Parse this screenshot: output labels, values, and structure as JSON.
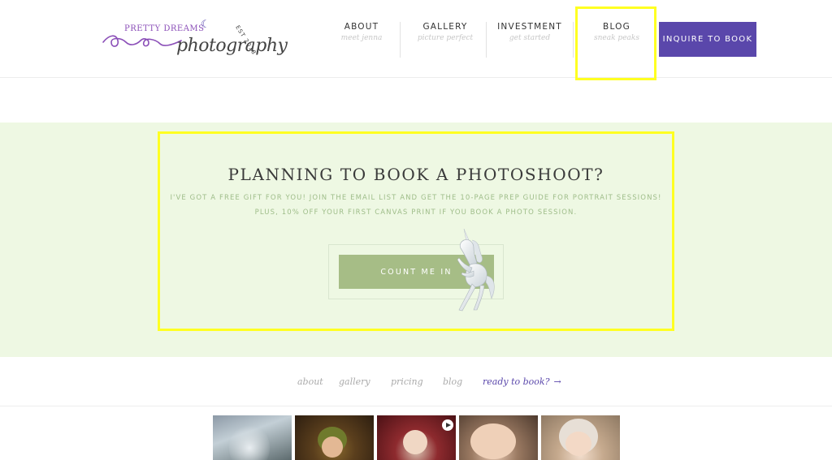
{
  "brand": {
    "name_top": "PRETTY DREAMS",
    "name_script": "photography",
    "est": "EST 2018"
  },
  "nav": {
    "items": [
      {
        "label": "ABOUT",
        "sub": "meet jenna"
      },
      {
        "label": "GALLERY",
        "sub": "picture perfect"
      },
      {
        "label": "INVESTMENT",
        "sub": "get started"
      },
      {
        "label": "BLOG",
        "sub": "sneak peaks"
      }
    ],
    "cta_label": "INQUIRE TO BOOK"
  },
  "promo": {
    "title": "PLANNING TO BOOK A PHOTOSHOOT?",
    "line1": "I'VE GOT A FREE GIFT FOR YOU! JOIN THE EMAIL LIST AND GET THE 10-PAGE PREP GUIDE FOR PORTRAIT SESSIONS!",
    "line2": "PLUS, 10% OFF YOUR FIRST CANVAS PRINT IF YOU BOOK A PHOTO SESSION.",
    "button_label": "COUNT ME IN"
  },
  "footer_nav": {
    "about": "about",
    "gallery": "gallery",
    "pricing": "pricing",
    "blog": "blog",
    "book": "ready to book?",
    "arrow": "→"
  },
  "colors": {
    "accent": "#5a47ab",
    "cta_green": "#a6bd86",
    "promo_bg": "#eef8e3",
    "highlight": "#ffff22"
  },
  "icons": [
    "moon-icon",
    "swirl-icon",
    "unicorn-illustration",
    "play-icon",
    "arrow-right-icon"
  ]
}
